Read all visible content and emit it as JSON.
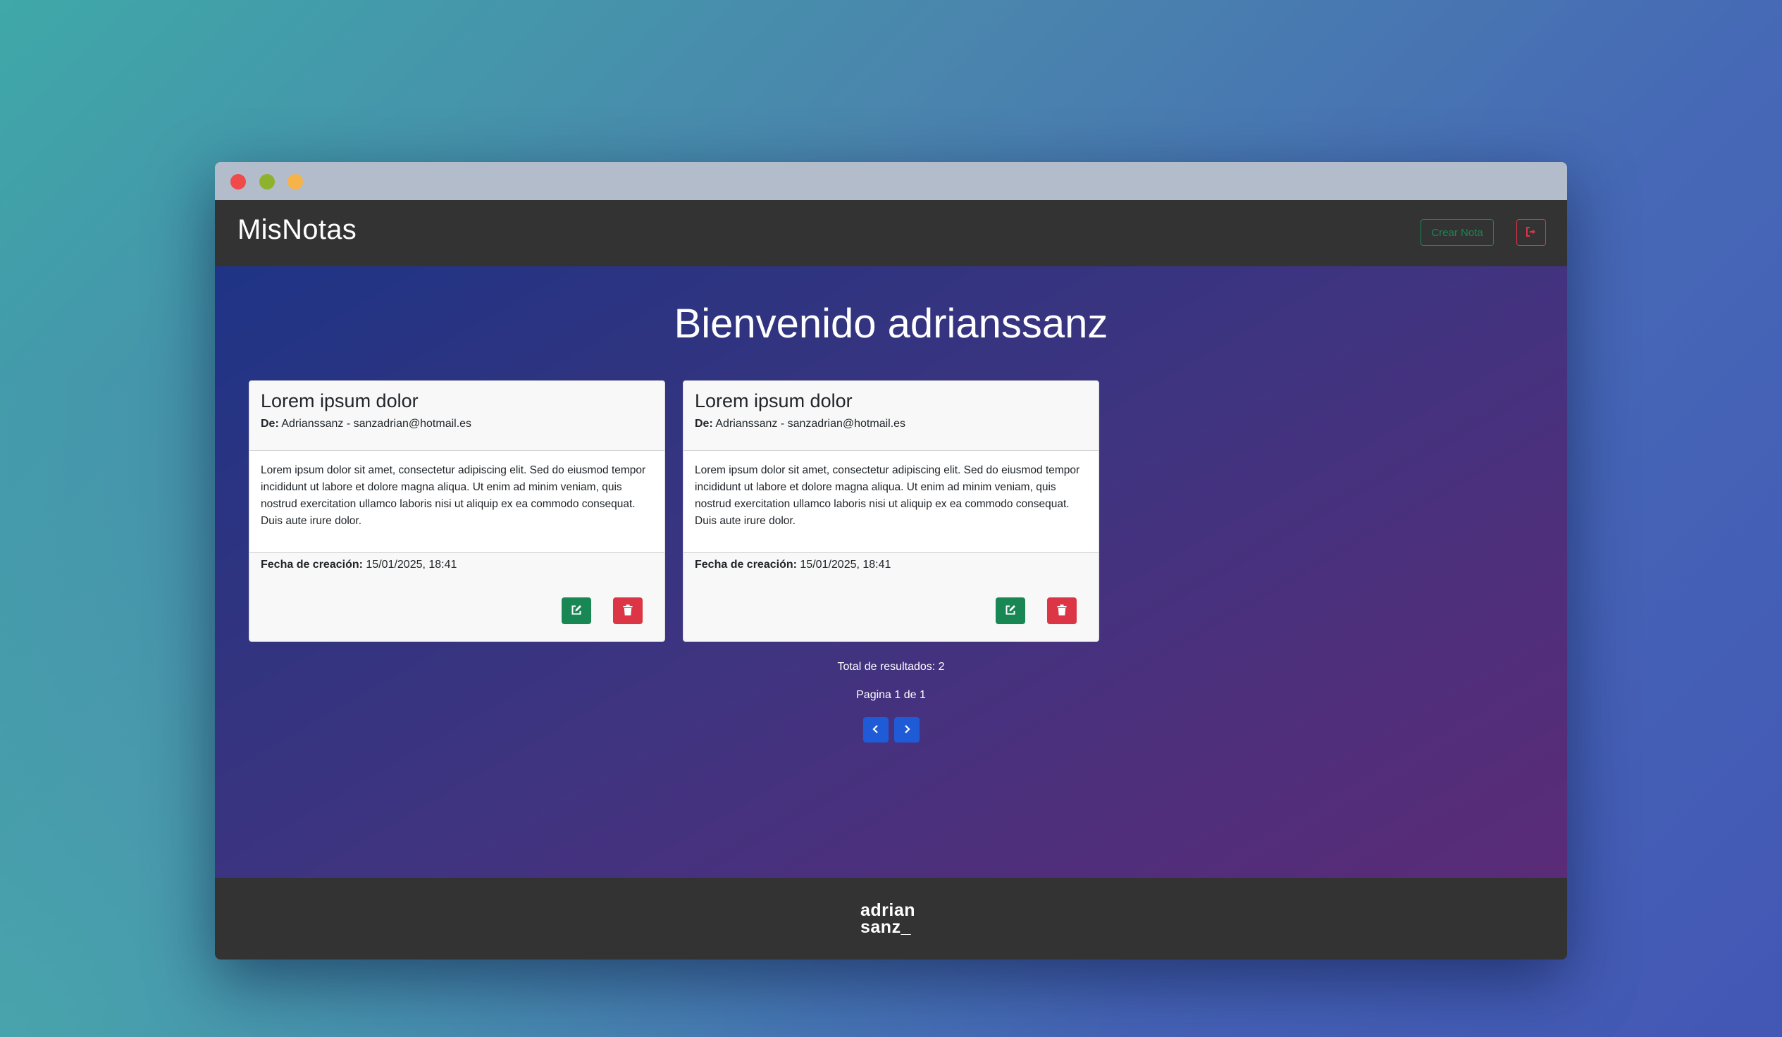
{
  "app": {
    "brand": "MisNotas"
  },
  "navbar": {
    "create_label": "Crear Nota",
    "logout_icon": "sign-out-icon"
  },
  "main": {
    "welcome": "Bienvenido adrianssanz",
    "notes": [
      {
        "title": "Lorem ipsum dolor",
        "author_label": "De:",
        "author": "Adrianssanz - sanzadrian@hotmail.es",
        "body": "Lorem ipsum dolor sit amet, consectetur adipiscing elit. Sed do eiusmod tempor incididunt ut labore et dolore magna aliqua. Ut enim ad minim veniam, quis nostrud exercitation ullamco laboris nisi ut aliquip ex ea commodo consequat. Duis aute irure dolor.",
        "date_label": "Fecha de creación:",
        "date": "15/01/2025, 18:41"
      },
      {
        "title": "Lorem ipsum dolor",
        "author_label": "De:",
        "author": "Adrianssanz - sanzadrian@hotmail.es",
        "body": "Lorem ipsum dolor sit amet, consectetur adipiscing elit. Sed do eiusmod tempor incididunt ut labore et dolore magna aliqua. Ut enim ad minim veniam, quis nostrud exercitation ullamco laboris nisi ut aliquip ex ea commodo consequat. Duis aute irure dolor.",
        "date_label": "Fecha de creación:",
        "date": "15/01/2025, 18:41"
      }
    ],
    "total_results": "Total de resultados: 2",
    "page_info": "Pagina 1 de 1"
  },
  "footer": {
    "logo_line1": "adrian",
    "logo_line2": "sanz_"
  },
  "colors": {
    "success": "#198754",
    "danger": "#dc3545",
    "primary": "#1f5bd6",
    "navbar": "#333333"
  }
}
